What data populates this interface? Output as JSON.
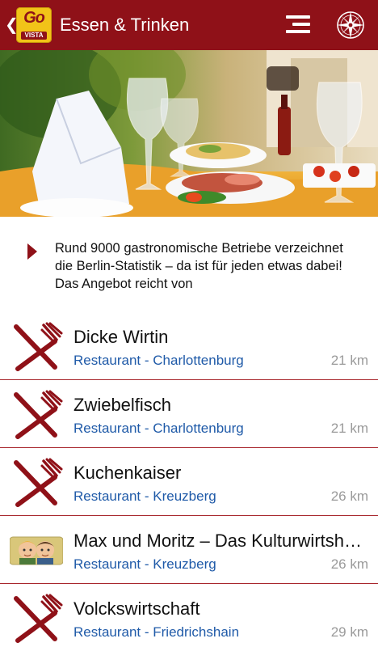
{
  "header": {
    "back_glyph": "❮",
    "logo_top": "Go",
    "logo_bottom": "VISTA",
    "title": "Essen & Trinken",
    "menu_icon": "menu-icon",
    "compass_icon": "compass-icon"
  },
  "intro": {
    "text": "Rund 9000 gastronomische Betriebe verzeichnet die Berlin-Statistik – da ist für jeden etwas dabei! Das Angebot reicht von"
  },
  "colors": {
    "brand": "#8f1118",
    "link": "#1f5aa8",
    "distance": "#9a9a9a",
    "logo": "#f2c318"
  },
  "list": {
    "items": [
      {
        "name": "Dicke Wirtin",
        "subtitle": "Restaurant - Charlottenburg",
        "distance": "21 km",
        "icon": "fork-knife-icon"
      },
      {
        "name": "Zwiebelfisch",
        "subtitle": "Restaurant - Charlottenburg",
        "distance": "21 km",
        "icon": "fork-knife-icon"
      },
      {
        "name": "Kuchenkaiser",
        "subtitle": "Restaurant - Kreuzberg",
        "distance": "26 km",
        "icon": "fork-knife-icon"
      },
      {
        "name": "Max und Moritz – Das Kulturwirtshaus",
        "subtitle": "Restaurant - Kreuzberg",
        "distance": "26 km",
        "icon": "max-moritz-thumbnail"
      },
      {
        "name": "Volckswirtschaft",
        "subtitle": "Restaurant - Friedrichshain",
        "distance": "29 km",
        "icon": "fork-knife-icon"
      }
    ]
  }
}
